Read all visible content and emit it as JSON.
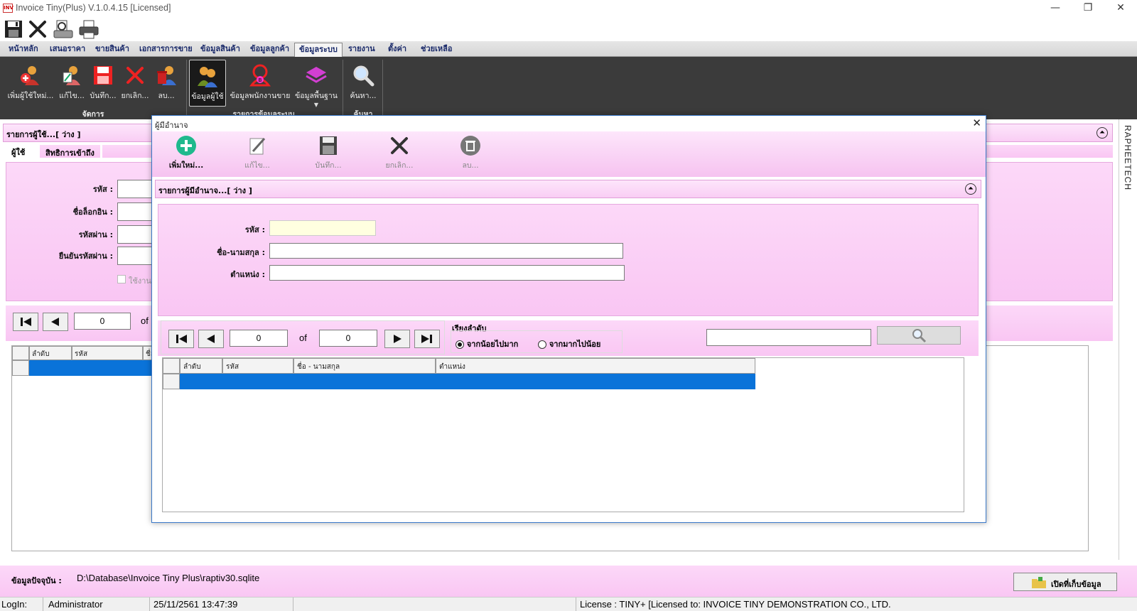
{
  "window": {
    "title": "Invoice Tiny(Plus)  V.1.0.4.15 [Licensed]",
    "app_icon_text": "INV",
    "minimize": "—",
    "restore": "❐",
    "close": "✕"
  },
  "menu": {
    "tabs": [
      "หน้าหลัก",
      "เสนอราคา",
      "ขายสินค้า",
      "เอกสารการขาย",
      "ข้อมูลสินค้า",
      "ข้อมูลลูกค้า",
      "ข้อมูลระบบ",
      "รายงาน",
      "ตั้งค่า",
      "ช่วยเหลือ"
    ],
    "active": "ข้อมูลระบบ"
  },
  "ribbon": {
    "manage_group": {
      "label": "จัดการ",
      "buttons": [
        "เพิ่มผู้ใช้ใหม่...",
        "แก้ไข...",
        "บันทึก...",
        "ยกเลิก...",
        "ลบ..."
      ]
    },
    "system_group": {
      "label": "รายการข้อมูลระบบ",
      "buttons": [
        "ข้อมูลผู้ใช้",
        "ข้อมูลพนักงานขาย",
        "ข้อมูลพื้นฐาน"
      ]
    },
    "search_group": {
      "label": "ค้นหา",
      "buttons": [
        "ค้นหา..."
      ]
    }
  },
  "user_panel": {
    "header": "รายการผู้ใช้...[ ว่าง ]",
    "tabs": [
      "ผู้ใช้",
      "สิทธิการเข้าถึง"
    ],
    "fields": [
      "รหัส :",
      "ชื่อล็อกอิน :",
      "รหัสผ่าน :",
      "ยืนยันรหัสผ่าน :"
    ],
    "checkbox_label": "ใช้งาน",
    "nav_value": "0",
    "of_label": "of",
    "columns": [
      "ลำดับ",
      "รหัส",
      "ชื่อ"
    ]
  },
  "side_label": "RAPHEETECH",
  "dialog": {
    "title": "ผู้มีอำนาจ",
    "close": "✕",
    "toolbar": [
      "เพิ่มใหม่...",
      "แก้ไข...",
      "บันทึก...",
      "ยกเลิก...",
      "ลบ..."
    ],
    "section_header": "รายการผู้มีอำนาจ...[ ว่าง ]",
    "fields": {
      "code_label": "รหัส :",
      "name_label": "ชื่อ-นามสกุล :",
      "position_label": "ตำแหน่ง :"
    },
    "nav": {
      "current": "0",
      "of_label": "of",
      "total": "0"
    },
    "sort": {
      "label": "เรียงลำดับ",
      "asc": "จากน้อยไปมาก",
      "desc": "จากมากไปน้อย",
      "selected": "asc"
    },
    "columns": [
      "ลำดับ",
      "รหัส",
      "ชื่อ - นามสกุล",
      "ตำแหน่ง"
    ]
  },
  "db_bar": {
    "label": "ข้อมูลปัจจุบัน :",
    "path": "D:\\Database\\Invoice Tiny Plus\\raptiv30.sqlite",
    "open_button": "เปิดที่เก็บข้อมูล"
  },
  "status": {
    "login_label": "LogIn:",
    "user": "Administrator",
    "datetime": "25/11/2561 13:47:39",
    "license": "License : TINY+ [Licensed to: INVOICE TINY DEMONSTRATION CO., LTD."
  }
}
